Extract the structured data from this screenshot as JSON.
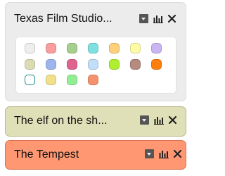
{
  "cards": {
    "expanded": {
      "title": "Texas Film Studio..."
    },
    "elf": {
      "title": "The elf on the sh..."
    },
    "tempest": {
      "title": "The Tempest"
    }
  },
  "palette": {
    "rows": [
      [
        "#eeeeee",
        "#fa9d9d",
        "#a5cf8d",
        "#7fe0e0",
        "#fdd07a",
        "#fdfba4",
        "#cbb4f2"
      ],
      [
        "#dcdcb4",
        "#9eb4ed",
        "#e0628f",
        "#c2def8",
        "#b0ee32",
        "#b58a7f",
        "#ff7f0e"
      ],
      [
        "#ffffff",
        "#f0e08a",
        "#92ee92",
        "#f5926e"
      ]
    ],
    "selected_index": 14
  },
  "icons": {
    "dropdown": "dropdown-icon",
    "chart": "bar-chart-icon",
    "close": "close-icon"
  }
}
